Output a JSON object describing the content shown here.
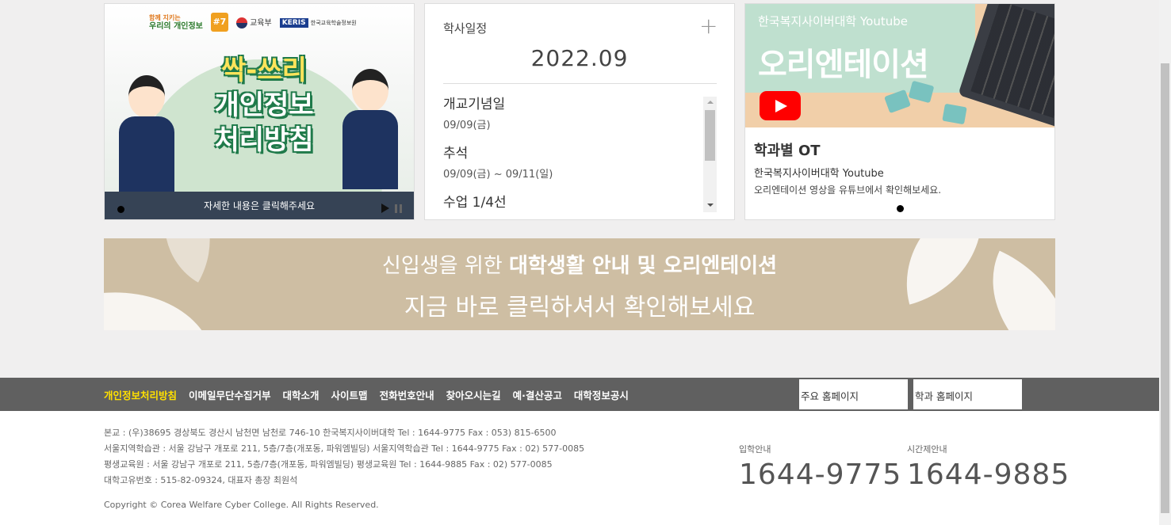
{
  "privacy_card": {
    "logo_text_1": "함께 지키는",
    "logo_text_2": "우리의 개인정보",
    "badge": "#7",
    "ministry": "교육부",
    "keris": "KERIS",
    "keris_name": "한국교육학술정보원",
    "headline_1": "싹-쓰리",
    "headline_2": "개인정보",
    "headline_3": "처리방침",
    "caption": "자세한 내용은 클릭해주세요"
  },
  "schedule": {
    "title": "학사일정",
    "plus": "+",
    "month": "2022.09",
    "events": [
      {
        "name": "개교기념일",
        "date": "09/09(금)"
      },
      {
        "name": "추석",
        "date": "09/09(금) ~ 09/11(일)"
      },
      {
        "name": "수업 1/4선",
        "date": ""
      }
    ]
  },
  "youtube": {
    "overlay_small": "한국복지사이버대학 Youtube",
    "overlay_big": "오리엔테이션",
    "title": "학과별 OT",
    "subtitle": "한국복지사이버대학 Youtube",
    "desc": "오리엔테이션 영상을 유튜브에서 확인해보세요."
  },
  "banner": {
    "line1_light": "신입생을 위한 ",
    "line1_bold": "대학생활 안내 및 오리엔테이션",
    "line2": "지금 바로 클릭하셔서 확인해보세요"
  },
  "footer_nav": {
    "links": [
      "개인정보처리방침",
      "이메일무단수집거부",
      "대학소개",
      "사이트맵",
      "전화번호안내",
      "찾아오시는길",
      "예·결산공고",
      "대학정보공시"
    ],
    "select1": "주요 홈페이지",
    "select2": "학과 홈페이지",
    "highlight_color": "#ffe000"
  },
  "footer": {
    "address_lines": [
      "본교 : (우)38695 경상북도 경산시 남천면 남천로 746-10 한국복지사이버대학 Tel : 1644-9775 Fax : 053) 815-6500",
      "서울지역학습관 : 서울 강남구 개포로 211, 5층/7층(개포동, 파워엠빌딩) 서울지역학습관 Tel : 1644-9775 Fax : 02) 577-0085",
      "평생교육원 : 서울 강남구 개포로 211, 5층/7층(개포동, 파워엠빌딩) 평생교육원 Tel : 1644-9885 Fax : 02) 577-0085",
      "대학고유번호 : 515-82-09324, 대표자 총장 최원석"
    ],
    "copyright": "Copyright © Corea Welfare Cyber College. All Rights Reserved.",
    "phone1_label": "입학안내",
    "phone1": "1644-9775",
    "phone2_label": "시간제안내",
    "phone2": "1644-9885"
  }
}
